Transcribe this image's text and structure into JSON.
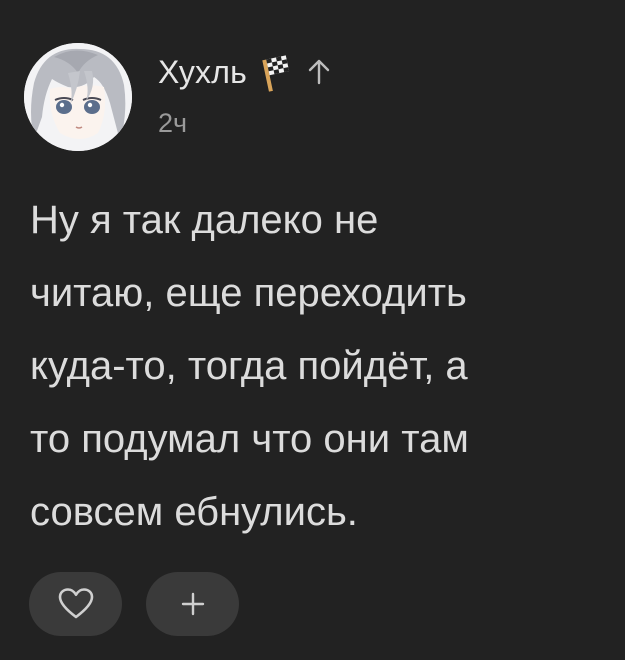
{
  "comment": {
    "author": {
      "name": "Хухль",
      "badge_icon": "checkered-flag-icon",
      "status_icon": "arrow-up-icon"
    },
    "timestamp": "2ч",
    "text_lines": [
      "Ну я так далеко не",
      "читаю, еще переходить",
      "куда-то, тогда пойдёт, а",
      "то подумал что они там",
      "совсем ебнулись."
    ],
    "actions": {
      "like_icon": "heart-icon",
      "add_icon": "plus-icon"
    }
  },
  "colors": {
    "background": "#222222",
    "text": "#dcdcdc",
    "muted_text": "#9a9a9a",
    "button_bg": "#3a3a3a",
    "icon": "#c8c8c8"
  }
}
